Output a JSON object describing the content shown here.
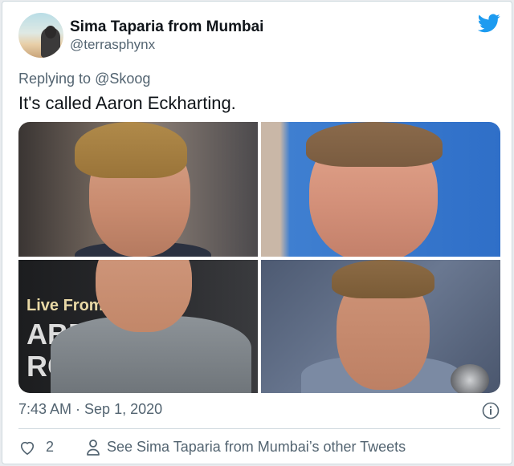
{
  "tweet": {
    "author_name": "Sima Taparia from Mumbai",
    "author_handle": "@terrasphynx",
    "replying_to_prefix": "Replying to",
    "replying_to_handle": "@Skoog",
    "text": "It's called Aaron Eckharting.",
    "timestamp": "7:43 AM · Sep 1, 2020",
    "like_count": "2",
    "see_more_label": "See Sima Taparia from Mumbai’s other Tweets"
  },
  "media": {
    "photos": [
      {
        "name": "photo-top-left"
      },
      {
        "name": "photo-top-right"
      },
      {
        "name": "photo-bottom-left",
        "sign_line1": "Live From",
        "sign_line2": "ABBEY",
        "sign_line3": "RO"
      },
      {
        "name": "photo-bottom-right"
      }
    ]
  },
  "icons": {
    "brand": "twitter-bird-icon",
    "info": "info-icon",
    "like": "heart-icon",
    "profile": "person-icon"
  },
  "colors": {
    "twitter_blue": "#1d9bf0",
    "secondary_text": "#536471",
    "primary_text": "#0f1419",
    "border": "#cfd9de"
  }
}
